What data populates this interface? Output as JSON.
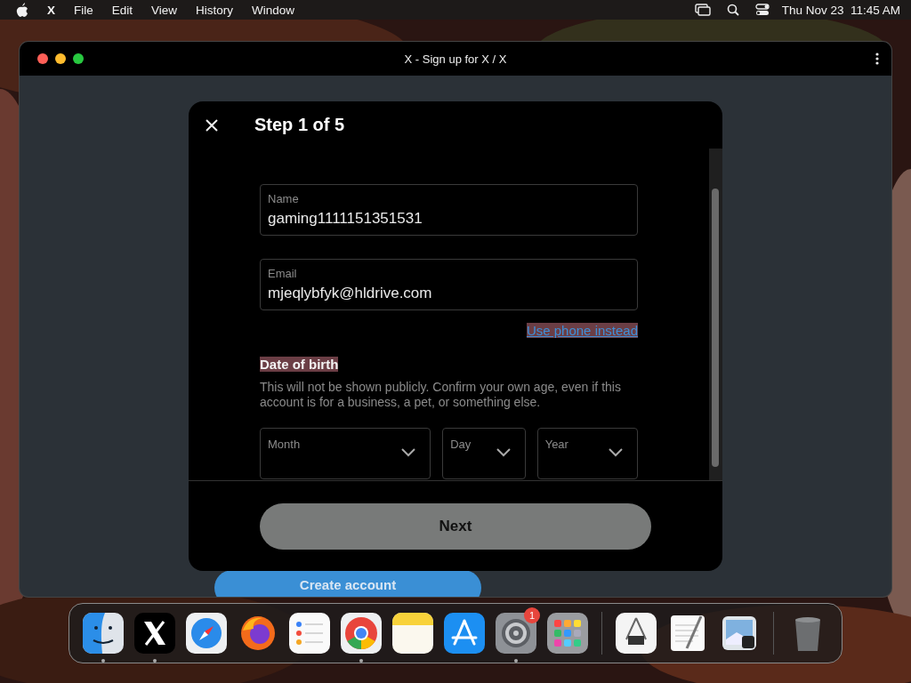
{
  "menu_bar": {
    "app": "X",
    "menus": [
      "File",
      "Edit",
      "View",
      "History",
      "Window"
    ],
    "clock": "Thu Nov 23  11:45 AM"
  },
  "window": {
    "title": "X - Sign up for X / X"
  },
  "page": {
    "create_account": "Create account"
  },
  "dialog": {
    "step": "Step 1 of 5",
    "fields": [
      {
        "label": "Name",
        "value": "gaming1111151351531"
      },
      {
        "label": "Email",
        "value": "mjeqlybfyk@hldrive.com"
      }
    ],
    "switch_link": {
      "text": "Use phone instead",
      "highlighted": true
    },
    "dob": {
      "title": "Date of birth",
      "highlighted": true,
      "note": "This will not be shown publicly. Confirm your own age, even if this account is for a business, a pet, or something else.",
      "selects": [
        {
          "label": "Month"
        },
        {
          "label": "Day"
        },
        {
          "label": "Year"
        }
      ]
    },
    "next": "Next"
  },
  "dock": {
    "groups": [
      {
        "items": [
          {
            "kind": "finder",
            "running": true
          },
          {
            "kind": "x",
            "running": true
          },
          {
            "kind": "safari",
            "running": false
          },
          {
            "kind": "firefox",
            "running": false
          },
          {
            "kind": "reminders",
            "running": false
          },
          {
            "kind": "chrome",
            "running": true
          },
          {
            "kind": "notes",
            "running": false
          },
          {
            "kind": "appstore",
            "running": false
          },
          {
            "kind": "settings",
            "running": true,
            "badge": "1"
          },
          {
            "kind": "launchpad",
            "running": false
          }
        ]
      },
      {
        "items": [
          {
            "kind": "sysinfo",
            "running": false
          },
          {
            "kind": "textedit",
            "running": false
          },
          {
            "kind": "preview",
            "running": false
          }
        ]
      },
      {
        "items": [
          {
            "kind": "trash",
            "running": false
          }
        ]
      }
    ]
  }
}
